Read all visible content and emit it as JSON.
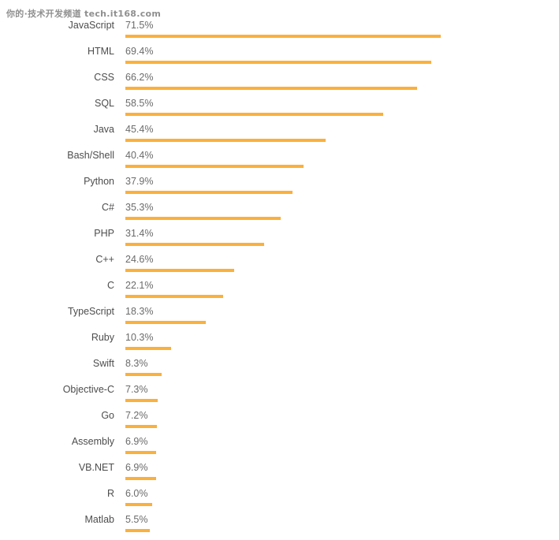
{
  "watermark": {
    "text": "你的·技术开发频道 tech.it168.com"
  },
  "colors": {
    "bar": "#fbb03b",
    "label_text": "#4d4d4d",
    "value_text": "#6b6b6b",
    "background": "#ffffff"
  },
  "chart_data": {
    "type": "bar",
    "orientation": "horizontal",
    "title": "",
    "subtitle": "",
    "xlabel": "",
    "ylabel": "",
    "grid": false,
    "legend": "none",
    "xlim": [
      0,
      71.5
    ],
    "value_suffix": "%",
    "categories": [
      "JavaScript",
      "HTML",
      "CSS",
      "SQL",
      "Java",
      "Bash/Shell",
      "Python",
      "C#",
      "PHP",
      "C++",
      "C",
      "TypeScript",
      "Ruby",
      "Swift",
      "Objective-C",
      "Go",
      "Assembly",
      "VB.NET",
      "R",
      "Matlab"
    ],
    "values": [
      71.5,
      69.4,
      66.2,
      58.5,
      45.4,
      40.4,
      37.9,
      35.3,
      31.4,
      24.6,
      22.1,
      18.3,
      10.3,
      8.3,
      7.3,
      7.2,
      6.9,
      6.9,
      6.0,
      5.5
    ],
    "labels": [
      "71.5%",
      "69.4%",
      "66.2%",
      "58.5%",
      "45.4%",
      "40.4%",
      "37.9%",
      "35.3%",
      "31.4%",
      "24.6%",
      "22.1%",
      "18.3%",
      "10.3%",
      "8.3%",
      "7.3%",
      "7.2%",
      "6.9%",
      "6.9%",
      "6.0%",
      "5.5%"
    ]
  }
}
